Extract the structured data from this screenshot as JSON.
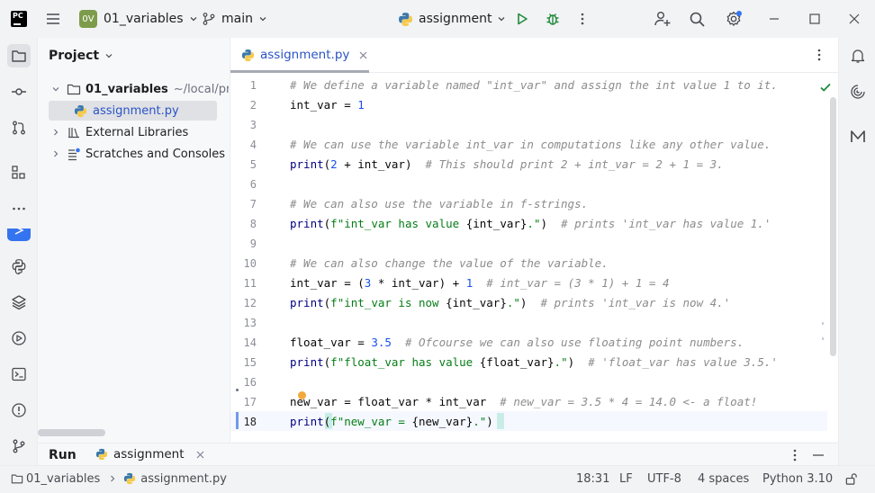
{
  "titlebar": {
    "app_logo": "PC",
    "project_badge": "0V",
    "project_name": "01_variables",
    "branch": "main",
    "run_config": "assignment",
    "icons": [
      "hamburger-menu-icon",
      "git-branch-icon",
      "python-icon",
      "run-icon",
      "debug-icon",
      "more-vert-icon",
      "add-user-icon",
      "search-icon",
      "settings-icon",
      "minimize-icon",
      "maximize-icon",
      "close-icon"
    ]
  },
  "left_strip": [
    "project-folder-icon",
    "commit-icon",
    "pull-requests-icon",
    "structure-icon",
    "more-horiz-icon",
    "run-tool-icon",
    "python-packages-icon",
    "layers-icon",
    "services-icon",
    "terminal-icon",
    "problems-icon",
    "git-icon"
  ],
  "project": {
    "title": "Project",
    "root_name": "01_variables",
    "root_path": "~/local/progr",
    "file": "assignment.py",
    "external": "External Libraries",
    "scratches": "Scratches and Consoles"
  },
  "editor": {
    "tab": "assignment.py",
    "line_numbers": [
      "1",
      "2",
      "3",
      "4",
      "5",
      "6",
      "7",
      "8",
      "9",
      "10",
      "11",
      "12",
      "13",
      "14",
      "15",
      "16",
      "17",
      "18"
    ],
    "current_line": "18"
  },
  "code": [
    [
      {
        "t": "# We define a variable named \"int_var\" and assign the int value 1 to it.",
        "c": "c-com"
      }
    ],
    [
      {
        "t": "int_var = ",
        "c": ""
      },
      {
        "t": "1",
        "c": "c-num"
      }
    ],
    [],
    [
      {
        "t": "# We can use the variable int_var in computations like any other value.",
        "c": "c-com"
      }
    ],
    [
      {
        "t": "print",
        "c": "c-fn"
      },
      {
        "t": "(",
        "c": ""
      },
      {
        "t": "2",
        "c": "c-num"
      },
      {
        "t": " + int_var)  ",
        "c": ""
      },
      {
        "t": "# This should print 2 + int_var = 2 + 1 = 3.",
        "c": "c-com"
      }
    ],
    [],
    [
      {
        "t": "# We can also use the variable in f-strings.",
        "c": "c-com"
      }
    ],
    [
      {
        "t": "print",
        "c": "c-fn"
      },
      {
        "t": "(",
        "c": ""
      },
      {
        "t": "f\"int_var has value ",
        "c": "c-str"
      },
      {
        "t": "{int_var}",
        "c": ""
      },
      {
        "t": ".\"",
        "c": "c-str"
      },
      {
        "t": ")  ",
        "c": ""
      },
      {
        "t": "# prints 'int_var has value 1.'",
        "c": "c-com"
      }
    ],
    [],
    [
      {
        "t": "# We can also change the value of the variable.",
        "c": "c-com"
      }
    ],
    [
      {
        "t": "int_var = (",
        "c": ""
      },
      {
        "t": "3",
        "c": "c-num"
      },
      {
        "t": " * int_var) + ",
        "c": ""
      },
      {
        "t": "1",
        "c": "c-num"
      },
      {
        "t": "  ",
        "c": ""
      },
      {
        "t": "# int_var = (3 * 1) + 1 = 4",
        "c": "c-com"
      }
    ],
    [
      {
        "t": "print",
        "c": "c-fn"
      },
      {
        "t": "(",
        "c": ""
      },
      {
        "t": "f\"int_var is now ",
        "c": "c-str"
      },
      {
        "t": "{int_var}",
        "c": ""
      },
      {
        "t": ".\"",
        "c": "c-str"
      },
      {
        "t": ")  ",
        "c": ""
      },
      {
        "t": "# prints 'int_var is now 4.'",
        "c": "c-com"
      }
    ],
    [],
    [
      {
        "t": "float_var = ",
        "c": ""
      },
      {
        "t": "3.5",
        "c": "c-num"
      },
      {
        "t": "  ",
        "c": ""
      },
      {
        "t": "# Ofcourse we can also use floating point numbers.",
        "c": "c-com"
      }
    ],
    [
      {
        "t": "print",
        "c": "c-fn"
      },
      {
        "t": "(",
        "c": ""
      },
      {
        "t": "f\"float_var has value ",
        "c": "c-str"
      },
      {
        "t": "{float_var}",
        "c": ""
      },
      {
        "t": ".\"",
        "c": "c-str"
      },
      {
        "t": ")  ",
        "c": ""
      },
      {
        "t": "# 'float_var has value 3.5.'",
        "c": "c-com"
      }
    ],
    [],
    [
      {
        "t": "new_var = float_var * int_var  ",
        "c": ""
      },
      {
        "t": "# new_var = 3.5 * 4 = 14.0 <- a float!",
        "c": "c-com"
      }
    ],
    [
      {
        "t": "print",
        "c": "c-fn"
      },
      {
        "t": "(",
        "c": ""
      },
      {
        "t": "f\"new_var = ",
        "c": "c-str"
      },
      {
        "t": "{new_var}",
        "c": ""
      },
      {
        "t": ".\"",
        "c": "c-str"
      },
      {
        "t": ")",
        "c": ""
      }
    ]
  ],
  "right_strip": [
    "notifications-icon",
    "ai-assistant-icon",
    "markdown-icon"
  ],
  "runbar": {
    "label": "Run",
    "tab": "assignment"
  },
  "statusbar": {
    "crumb_project": "01_variables",
    "crumb_file": "assignment.py",
    "position": "18:31",
    "line_sep": "LF",
    "encoding": "UTF-8",
    "indent": "4 spaces",
    "interpreter": "Python 3.10"
  },
  "colors": {
    "accent": "#3574f0",
    "run_green": "#208a3c",
    "pc_logo_bg": "#21d789",
    "project_badge": "#7d9c4b"
  }
}
